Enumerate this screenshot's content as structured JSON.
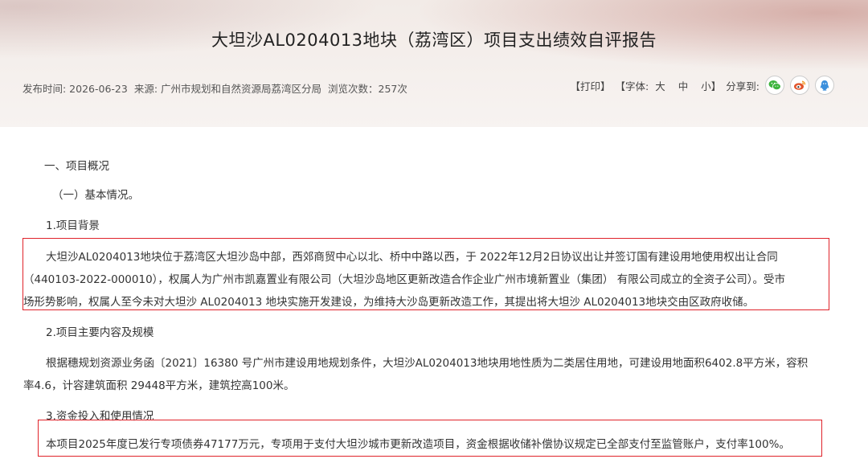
{
  "header": {
    "title": "大坦沙AL0204013地块（荔湾区）项目支出绩效自评报告",
    "publish_time": "发布时间: 2026-06-23",
    "source": "来源: 广州市规划和自然资源局荔湾区分局",
    "views": "浏览次数：257次"
  },
  "tools": {
    "print": "【打印】",
    "font_label": "【字体:",
    "font_large": "大",
    "font_medium": "中",
    "font_small": "小",
    "font_close": "】",
    "share_label": "分享到:"
  },
  "article": {
    "s1": "一、项目概况",
    "s1_1": "（一）基本情况。",
    "h1": "1.项目背景",
    "p1_line1": "大坦沙AL0204013地块位于荔湾区大坦沙岛中部，西郊商贸中心以北、桥中中路以西，于 2022年12月2日协议出让并签订国有建设用地使用权出让合同",
    "p1_line2": "（440103-2022-000010），权属人为广州市凯嘉置业有限公司（大坦沙岛地区更新改造合作企业广州市境新置业（集团） 有限公司成立的全资子公司）。受市",
    "p1_line3": "场形势影响，权属人至今未对大坦沙 AL0204013 地块实施开发建设，为维持大沙岛更新改造工作，其提出将大坦沙 AL0204013地块交由区政府收储。",
    "h2": "2.项目主要内容及规模",
    "p2_line1": "根据穗规划资源业务函〔2021〕16380 号广州市建设用地规划条件，大坦沙AL0204013地块用地性质为二类居住用地，可建设用地面积6402.8平方米，容积",
    "p2_line2": "率4.6，计容建筑面积 29448平方米，建筑控高100米。",
    "h3": "3.资金投入和使用情况",
    "p3_line1": "本项目2025年度已发行专项债券47177万元，专项用于支付大坦沙城市更新改造项目，资金根据收储补偿协议规定已全部支付至监管账户，支付率100%。"
  },
  "colors": {
    "highlight_box": "#e0232a",
    "wechat": "#3db43d",
    "weibo": "#e2552c",
    "qq": "#3b8fdc"
  },
  "icons": [
    "wechat-icon",
    "weibo-icon",
    "qq-icon"
  ]
}
